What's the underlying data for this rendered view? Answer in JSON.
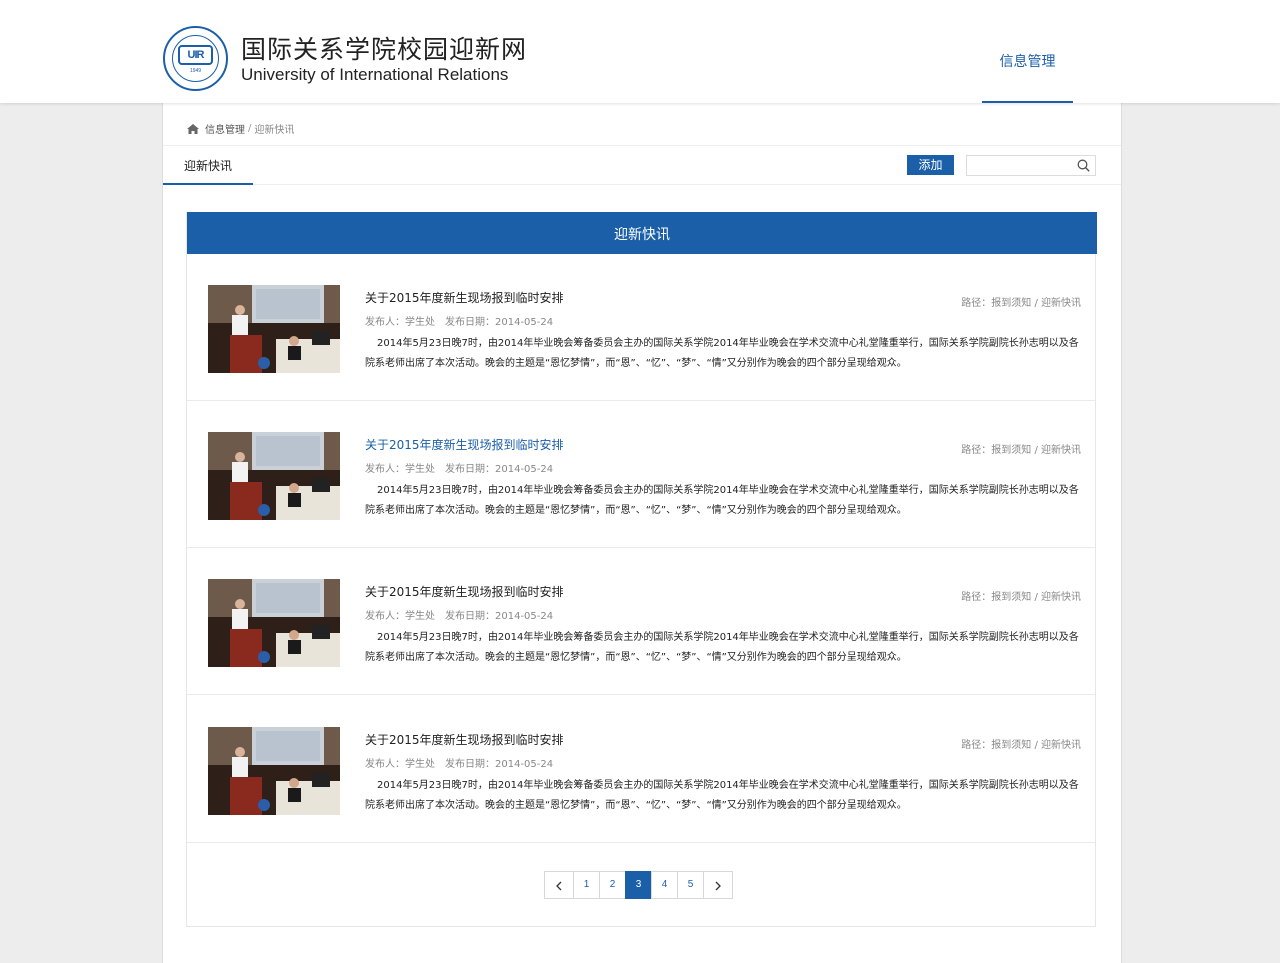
{
  "header": {
    "logo_title_cn": "国际关系学院校园迎新网",
    "logo_title_en": "University of International Relations",
    "logo_year": "1949",
    "logo_mark": "UIR",
    "nav": [
      {
        "label": "信息管理",
        "active": true
      }
    ]
  },
  "breadcrumb": {
    "home_icon": "home-icon",
    "items": [
      "信息管理",
      "迎新快讯"
    ],
    "separator": "/"
  },
  "tabbar": {
    "tabs": [
      {
        "label": "迎新快讯",
        "active": true
      }
    ],
    "add_label": "添加",
    "search_placeholder": "",
    "search_icon": "search-icon"
  },
  "content": {
    "heading": "迎新快讯",
    "news": [
      {
        "title": "关于2015年度新生现场报到临时安排",
        "publisher_label": "发布人：学生处",
        "date_label": "发布日期：2014-05-24",
        "path_label": "路径：报到须知 / 迎新快讯",
        "summary": "2014年5月23日晚7时，由2014年毕业晚会筹备委员会主办的国际关系学院2014年毕业晚会在学术交流中心礼堂隆重举行，国际关系学院副院长孙志明以及各院系老师出席了本次活动。晚会的主题是“恩忆梦情”，而“恩”、“忆”、“梦”、“情”又分别作为晚会的四个部分呈现给观众。",
        "highlighted": false
      },
      {
        "title": "关于2015年度新生现场报到临时安排",
        "publisher_label": "发布人：学生处",
        "date_label": "发布日期：2014-05-24",
        "path_label": "路径：报到须知 / 迎新快讯",
        "summary": "2014年5月23日晚7时，由2014年毕业晚会筹备委员会主办的国际关系学院2014年毕业晚会在学术交流中心礼堂隆重举行，国际关系学院副院长孙志明以及各院系老师出席了本次活动。晚会的主题是“恩忆梦情”，而“恩”、“忆”、“梦”、“情”又分别作为晚会的四个部分呈现给观众。",
        "highlighted": true
      },
      {
        "title": "关于2015年度新生现场报到临时安排",
        "publisher_label": "发布人：学生处",
        "date_label": "发布日期：2014-05-24",
        "path_label": "路径：报到须知 / 迎新快讯",
        "summary": "2014年5月23日晚7时，由2014年毕业晚会筹备委员会主办的国际关系学院2014年毕业晚会在学术交流中心礼堂隆重举行，国际关系学院副院长孙志明以及各院系老师出席了本次活动。晚会的主题是“恩忆梦情”，而“恩”、“忆”、“梦”、“情”又分别作为晚会的四个部分呈现给观众。",
        "highlighted": false
      },
      {
        "title": "关于2015年度新生现场报到临时安排",
        "publisher_label": "发布人：学生处",
        "date_label": "发布日期：2014-05-24",
        "path_label": "路径：报到须知 / 迎新快讯",
        "summary": "2014年5月23日晚7时，由2014年毕业晚会筹备委员会主办的国际关系学院2014年毕业晚会在学术交流中心礼堂隆重举行，国际关系学院副院长孙志明以及各院系老师出席了本次活动。晚会的主题是“恩忆梦情”，而“恩”、“忆”、“梦”、“情”又分别作为晚会的四个部分呈现给观众。",
        "highlighted": false
      }
    ]
  },
  "pagination": {
    "pages": [
      "1",
      "2",
      "3",
      "4",
      "5"
    ],
    "current": "3",
    "prev_icon": "chevron-left-icon",
    "next_icon": "chevron-right-icon"
  },
  "colors": {
    "primary": "#1a5fa8",
    "text": "#222222",
    "muted": "#888888",
    "background": "#ededed"
  }
}
